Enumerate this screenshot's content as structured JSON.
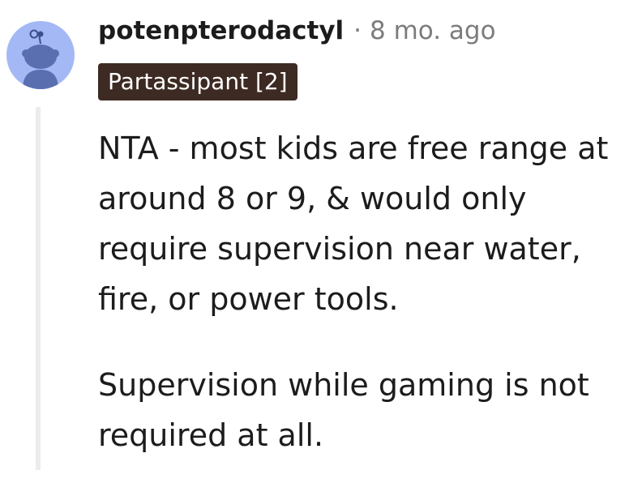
{
  "comment": {
    "username": "potenpterodactyl",
    "separator": "·",
    "timestamp": "8 mo. ago",
    "flair": "Partassipant [2]",
    "paragraphs": [
      "NTA - most kids are free range at around 8 or 9, & would only require supervision near water, fire, or power tools.",
      "Supervision while gaming is not required at all."
    ]
  },
  "avatar": {
    "icon": "reddit-snoo-icon",
    "background_color": "#a3b8f5",
    "figure_color": "#5a6fb0"
  },
  "colors": {
    "flair_background": "#3d2a22",
    "meta_text": "#7c7c7c",
    "thread_line": "#ececec"
  }
}
